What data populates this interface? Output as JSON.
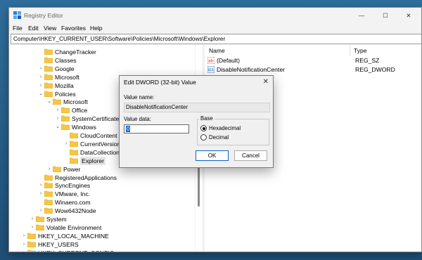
{
  "window": {
    "title": "Registry Editor"
  },
  "window_controls": {
    "minimize": "—",
    "maximize": "☐",
    "close": "✕"
  },
  "menu": [
    "File",
    "Edit",
    "View",
    "Favorites",
    "Help"
  ],
  "address": "Computer\\HKEY_CURRENT_USER\\Software\\Policies\\Microsoft\\Windows\\Explorer",
  "tree": [
    {
      "label": "ChangeTracker",
      "indent": 3,
      "chevron": ""
    },
    {
      "label": "Classes",
      "indent": 3,
      "chevron": ""
    },
    {
      "label": "Google",
      "indent": 3,
      "chevron": "›"
    },
    {
      "label": "Microsoft",
      "indent": 3,
      "chevron": "›"
    },
    {
      "label": "Mozilla",
      "indent": 3,
      "chevron": "›"
    },
    {
      "label": "Policies",
      "indent": 3,
      "chevron": "⌄"
    },
    {
      "label": "Microsoft",
      "indent": 4,
      "chevron": "⌄"
    },
    {
      "label": "Office",
      "indent": 5,
      "chevron": "›"
    },
    {
      "label": "SystemCertificates",
      "indent": 5,
      "chevron": "›"
    },
    {
      "label": "Windows",
      "indent": 5,
      "chevron": "⌄"
    },
    {
      "label": "CloudContent",
      "indent": 6,
      "chevron": ""
    },
    {
      "label": "CurrentVersion",
      "indent": 6,
      "chevron": "›"
    },
    {
      "label": "DataCollection",
      "indent": 6,
      "chevron": ""
    },
    {
      "label": "Explorer",
      "indent": 6,
      "chevron": "",
      "selected": true
    },
    {
      "label": "Power",
      "indent": 4,
      "chevron": "›"
    },
    {
      "label": "RegisteredApplications",
      "indent": 3,
      "chevron": ""
    },
    {
      "label": "SyncEngines",
      "indent": 3,
      "chevron": "›"
    },
    {
      "label": "VMware, Inc.",
      "indent": 3,
      "chevron": "›"
    },
    {
      "label": "Winaero.com",
      "indent": 3,
      "chevron": ""
    },
    {
      "label": "Wow6432Node",
      "indent": 3,
      "chevron": "›"
    },
    {
      "label": "System",
      "indent": 2,
      "chevron": "›"
    },
    {
      "label": "Volatile Environment",
      "indent": 2,
      "chevron": "›"
    },
    {
      "label": "HKEY_LOCAL_MACHINE",
      "indent": 1,
      "chevron": "›"
    },
    {
      "label": "HKEY_USERS",
      "indent": 1,
      "chevron": "›"
    },
    {
      "label": "HKEY_CURRENT_CONFIG",
      "indent": 1,
      "chevron": "›"
    }
  ],
  "list": {
    "columns": [
      "Name",
      "Type"
    ],
    "rows": [
      {
        "name": "(Default)",
        "type": "REG_SZ",
        "icon": "string-value-icon",
        "icon_text": "ab"
      },
      {
        "name": "DisableNotificationCenter",
        "type": "REG_DWORD",
        "icon": "binary-value-icon",
        "icon_text": "011"
      }
    ]
  },
  "dialog": {
    "title": "Edit DWORD (32-bit) Value",
    "close": "✕",
    "value_name_label": "Value name:",
    "value_name": "DisableNotificationCenter",
    "value_data_label": "Value data:",
    "value_data": "0",
    "base_label": "Base",
    "hex_label": "Hexadecimal",
    "dec_label": "Decimal",
    "base_selected": "Hexadecimal",
    "ok_label": "OK",
    "cancel_label": "Cancel"
  },
  "colors": {
    "accent": "#0a64c8",
    "folder": "#f6c644",
    "background": "#2f6e9c"
  }
}
